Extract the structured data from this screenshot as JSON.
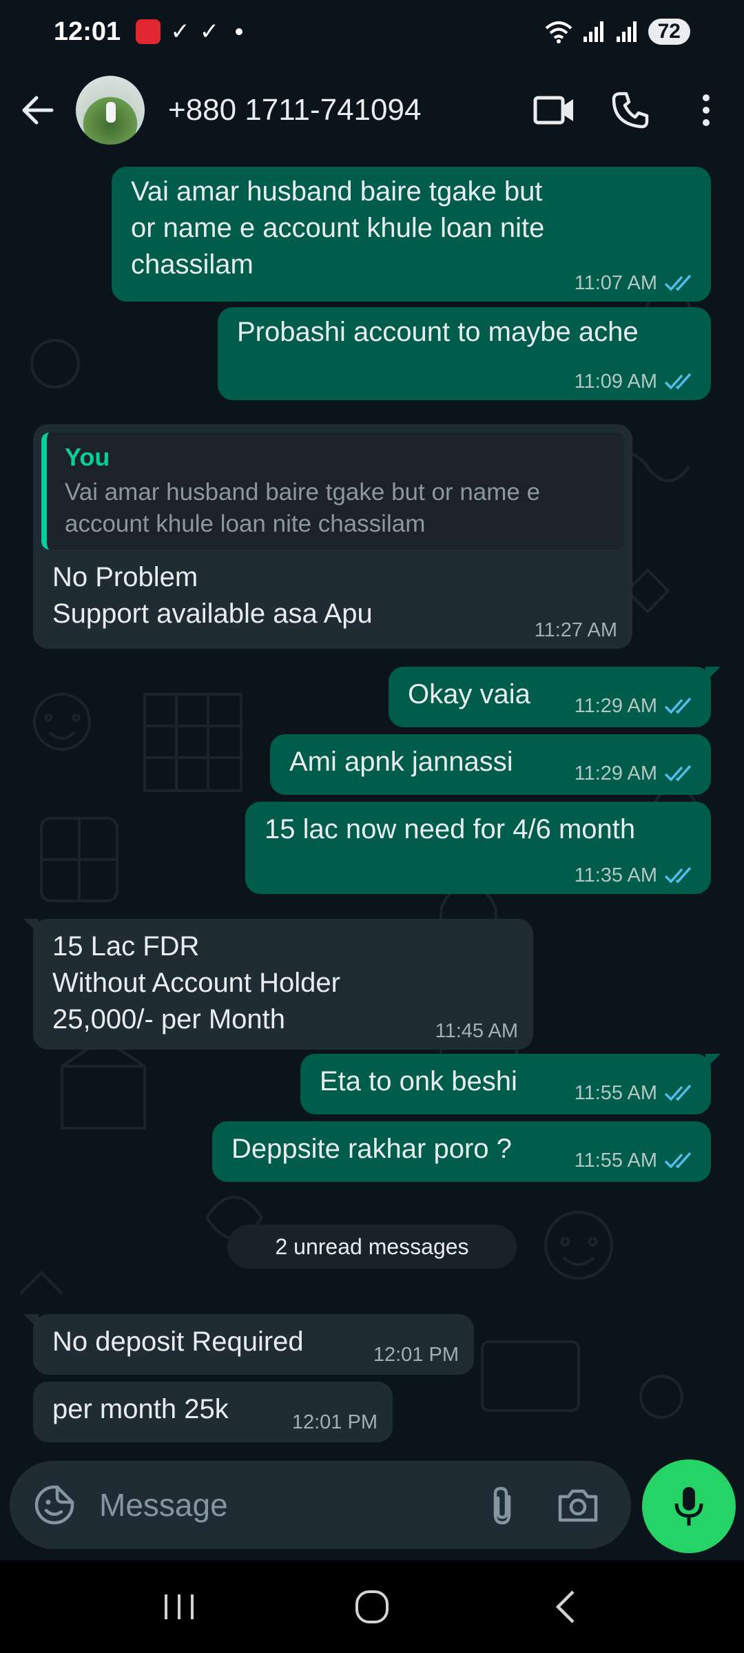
{
  "status_bar": {
    "time": "12:01",
    "battery": "72",
    "icons": [
      "app-notification-icon",
      "check-icon",
      "check-icon",
      "dot-icon",
      "wifi-icon",
      "signal-icon",
      "signal-icon",
      "battery-icon"
    ]
  },
  "header": {
    "contact_name": "+880 1711-741094",
    "icons": [
      "back-arrow-icon",
      "video-call-icon",
      "phone-icon",
      "more-vert-icon"
    ]
  },
  "messages": [
    {
      "dir": "out",
      "text": "Vai amar husband baire tgake but\nor name e account khule loan nite\nchassilam",
      "time": "11:07 AM",
      "read": true
    },
    {
      "dir": "out",
      "text": "Probashi account to maybe ache",
      "time": "11:09 AM",
      "read": true
    },
    {
      "dir": "in",
      "quote_author": "You",
      "quote_text": "Vai amar husband baire tgake but or name e\naccount khule loan nite chassilam",
      "text": "No Problem\nSupport available asa Apu",
      "time": "11:27 AM"
    },
    {
      "dir": "out",
      "text": "Okay vaia",
      "time": "11:29 AM",
      "read": true
    },
    {
      "dir": "out",
      "text": "Ami apnk jannassi",
      "time": "11:29 AM",
      "read": true
    },
    {
      "dir": "out",
      "text": "15 lac now need for 4/6 month",
      "time": "11:35 AM",
      "read": true
    },
    {
      "dir": "in",
      "text": "15 Lac FDR\nWithout Account Holder\n25,000/- per Month",
      "time": "11:45 AM"
    },
    {
      "dir": "out",
      "text": "Eta to onk beshi",
      "time": "11:55 AM",
      "read": true
    },
    {
      "dir": "out",
      "text": "Deppsite rakhar poro ?",
      "time": "11:55 AM",
      "read": true
    },
    {
      "dir": "in",
      "text": "No deposit Required",
      "time": "12:01 PM"
    },
    {
      "dir": "in",
      "text": "per month 25k",
      "time": "12:01 PM"
    }
  ],
  "unread_label": "2 unread messages",
  "composer": {
    "placeholder": "Message",
    "icons": [
      "emoji-icon",
      "attach-icon",
      "camera-icon",
      "mic-icon"
    ]
  },
  "nav_bar": {
    "icons": [
      "recent-apps-icon",
      "home-icon",
      "back-icon"
    ]
  },
  "colors": {
    "background": "#0b141a",
    "outgoing_bubble": "#005c4b",
    "incoming_bubble": "#202c33",
    "read_ticks": "#53bdeb",
    "accent": "#25d366"
  }
}
